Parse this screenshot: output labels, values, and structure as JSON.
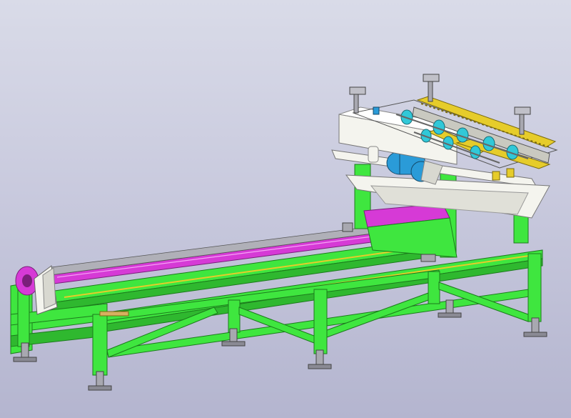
{
  "view": {
    "title": "",
    "background_top": "#d9dbe8",
    "background_bottom": "#b4b5cf"
  },
  "model": {
    "subject": "conveyor-saw-machine",
    "colors": {
      "frame": "#3fe63f",
      "frame_edge": "#1c7a1c",
      "rail": "#d63ad6",
      "housing": "#f4f4ee",
      "yellow": "#e6cc2a",
      "blue": "#31c8d8",
      "motor": "#2a9bd8",
      "steel": "#a8a8b0",
      "dark": "#4a4a55"
    }
  }
}
